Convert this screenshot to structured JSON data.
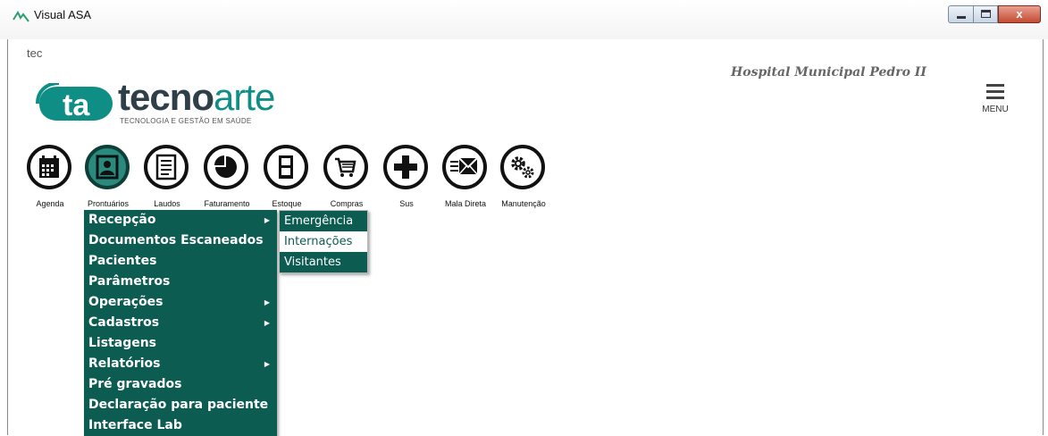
{
  "window": {
    "title": "Visual ASA",
    "controls": {
      "close_glyph": "x"
    }
  },
  "header": {
    "user": "tec",
    "hospital": "Hospital Municipal Pedro II",
    "menu_label": "MENU"
  },
  "logo": {
    "mark_text": "ta",
    "word_part1": "tecno",
    "word_part2": "arte",
    "subtitle": "TECNOLOGIA E GESTÃO EM SAÚDE"
  },
  "modules": [
    {
      "label": "Agenda",
      "icon": "calendar-icon"
    },
    {
      "label": "Prontuários",
      "icon": "patient-record-icon",
      "active": true
    },
    {
      "label": "Laudos",
      "icon": "document-lines-icon"
    },
    {
      "label": "Faturamento",
      "icon": "pie-chart-icon"
    },
    {
      "label": "Estoque",
      "icon": "cabinet-icon"
    },
    {
      "label": "Compras",
      "icon": "shopping-cart-icon"
    },
    {
      "label": "Sus",
      "icon": "medical-cross-icon"
    },
    {
      "label": "Mala Direta",
      "icon": "mail-icon"
    },
    {
      "label": "Manutenção",
      "icon": "gears-icon"
    }
  ],
  "dropdown": {
    "items": [
      {
        "label": "Recepção",
        "submenu": true
      },
      {
        "label": "Documentos Escaneados",
        "submenu": false
      },
      {
        "label": "Pacientes",
        "submenu": false
      },
      {
        "label": "Parâmetros",
        "submenu": false
      },
      {
        "label": "Operações",
        "submenu": true
      },
      {
        "label": "Cadastros",
        "submenu": true
      },
      {
        "label": "Listagens",
        "submenu": false
      },
      {
        "label": "Relatórios",
        "submenu": true
      },
      {
        "label": "Pré gravados",
        "submenu": false
      },
      {
        "label": "Declaração para paciente",
        "submenu": false
      },
      {
        "label": "Interface Lab",
        "submenu": false
      }
    ],
    "arrow_glyph": "▶"
  },
  "submenu": {
    "items": [
      {
        "label": "Emergência",
        "highlighted": true
      },
      {
        "label": "Internações",
        "highlighted": false
      },
      {
        "label": "Visitantes",
        "highlighted": true
      }
    ]
  },
  "colors": {
    "accent": "#0c5c52",
    "logo_teal": "#0f8e86",
    "logo_dark": "#2f3f4a"
  }
}
